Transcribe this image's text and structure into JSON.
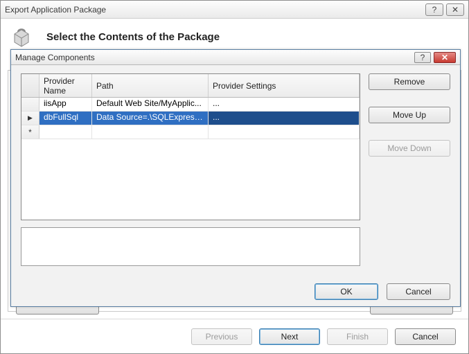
{
  "outer": {
    "title": "Export Application Package",
    "heading": "Select the Contents of the Package",
    "buttons": {
      "previous": "Previous",
      "next": "Next",
      "finish": "Finish",
      "cancel": "Cancel"
    }
  },
  "inner": {
    "title": "Manage Components",
    "columns": {
      "provider": "Provider Name",
      "path": "Path",
      "settings": "Provider Settings"
    },
    "rows": [
      {
        "provider": "iisApp",
        "path": "Default Web Site/MyApplic...",
        "settings": "...",
        "selected": false
      },
      {
        "provider": "dbFullSql",
        "path": "Data Source=.\\SQLExpress;Dat",
        "settings": "...",
        "selected": true
      }
    ],
    "side": {
      "remove": "Remove",
      "moveUp": "Move Up",
      "moveDown": "Move Down"
    },
    "ok": "OK",
    "cancel": "Cancel"
  },
  "glyphs": {
    "help": "?",
    "close": "✕",
    "rowPointer": "▶",
    "newRow": "*"
  }
}
